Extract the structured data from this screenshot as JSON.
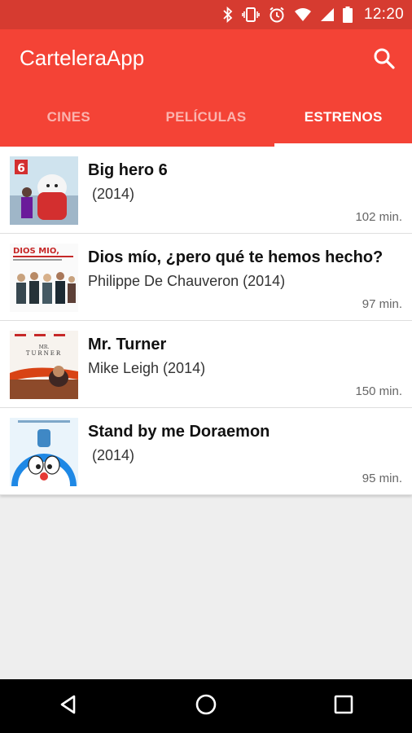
{
  "status_bar": {
    "time": "12:20",
    "icons": [
      "bluetooth-icon",
      "vibrate-icon",
      "alarm-icon",
      "wifi-icon",
      "signal-icon",
      "battery-icon"
    ]
  },
  "app_bar": {
    "title": "CarteleraApp",
    "search_icon": "search-icon",
    "color": "#f44336",
    "status_color": "#d63b30"
  },
  "tabs": [
    {
      "label": "CINES",
      "active": false
    },
    {
      "label": "PELÍCULAS",
      "active": false
    },
    {
      "label": "ESTRENOS",
      "active": true
    }
  ],
  "movies": [
    {
      "title": "Big hero 6",
      "meta": " (2014)",
      "duration": "102 min."
    },
    {
      "title": "Dios mío, ¿pero qué te hemos hecho?",
      "meta": "Philippe De Chauveron (2014)",
      "duration": "97 min."
    },
    {
      "title": "Mr. Turner",
      "meta": "Mike Leigh (2014)",
      "duration": "150 min."
    },
    {
      "title": "Stand by me Doraemon",
      "meta": " (2014)",
      "duration": "95 min."
    }
  ],
  "nav_bar": {
    "icons": [
      "back-icon",
      "home-icon",
      "recents-icon"
    ]
  }
}
